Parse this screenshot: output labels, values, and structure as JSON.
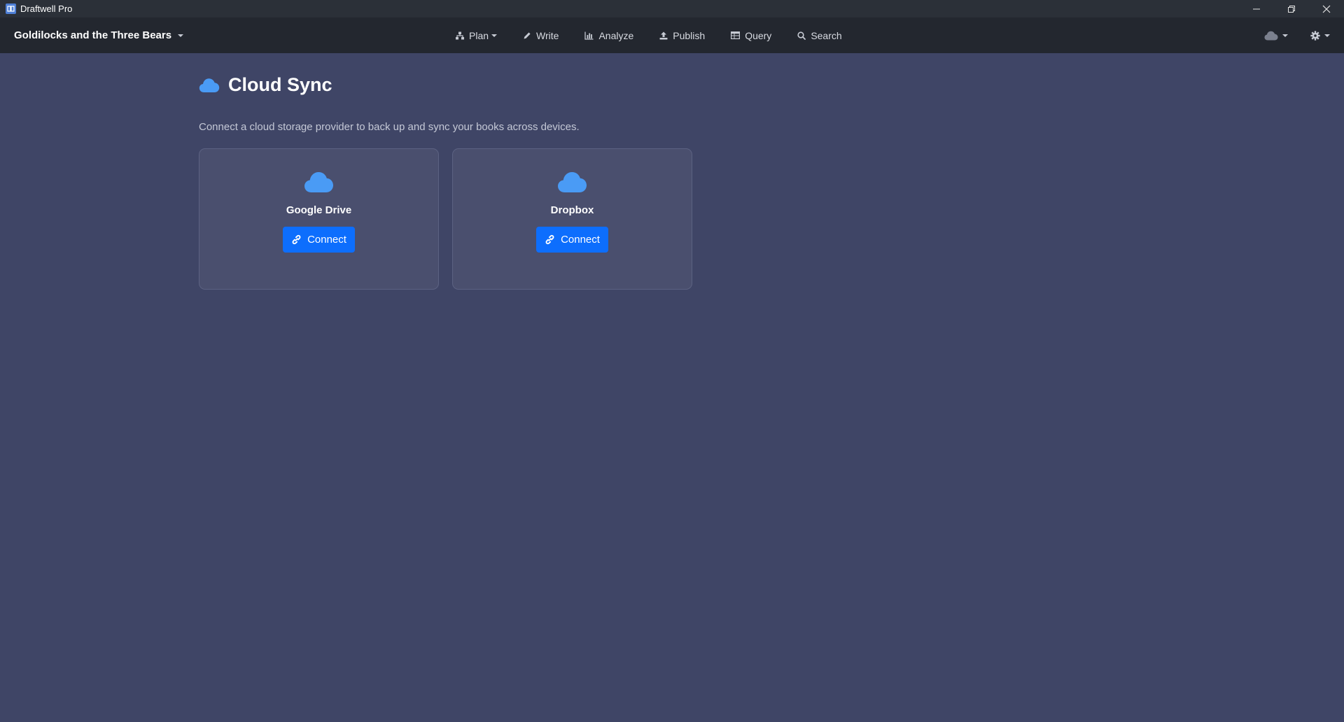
{
  "window": {
    "app_title": "Draftwell Pro",
    "controls": [
      {
        "name": "minimize-icon"
      },
      {
        "name": "restore-icon"
      },
      {
        "name": "close-icon"
      }
    ]
  },
  "navbar": {
    "project_title": "Goldilocks and the Three Bears",
    "items": [
      {
        "label": "Plan",
        "icon": "sitemap-icon",
        "dropdown": true
      },
      {
        "label": "Write",
        "icon": "pencil-icon",
        "dropdown": false
      },
      {
        "label": "Analyze",
        "icon": "bar-chart-icon",
        "dropdown": false
      },
      {
        "label": "Publish",
        "icon": "upload-icon",
        "dropdown": false
      },
      {
        "label": "Query",
        "icon": "table-icon",
        "dropdown": false
      },
      {
        "label": "Search",
        "icon": "search-icon",
        "dropdown": false
      }
    ],
    "right": [
      {
        "icon": "cloud-icon",
        "dropdown": true
      },
      {
        "icon": "gear-icon",
        "dropdown": true
      }
    ]
  },
  "page": {
    "title": "Cloud Sync",
    "title_icon": "cloud-icon",
    "description": "Connect a cloud storage provider to back up and sync your books across devices.",
    "providers": [
      {
        "name": "Google Drive",
        "icon": "cloud-icon",
        "button_label": "Connect",
        "button_icon": "link-icon"
      },
      {
        "name": "Dropbox",
        "icon": "cloud-icon",
        "button_label": "Connect",
        "button_icon": "link-icon"
      }
    ]
  },
  "colors": {
    "background": "#3f4566",
    "navbar": "#23272f",
    "titlebar": "#2b3038",
    "card": "#4a4f6e",
    "accent_icon": "#4a9bf5",
    "primary_button": "#0d6efd"
  }
}
